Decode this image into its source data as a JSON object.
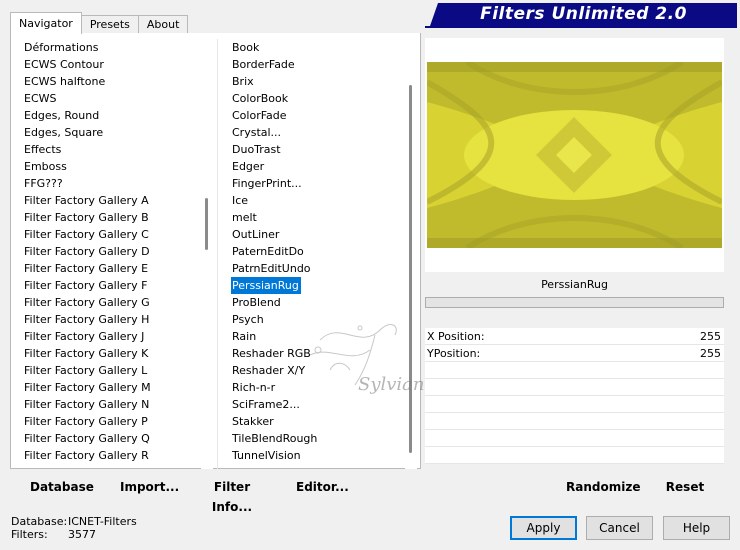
{
  "tabs": [
    {
      "label": "Navigator",
      "active": true
    },
    {
      "label": "Presets",
      "active": false
    },
    {
      "label": "About",
      "active": false
    }
  ],
  "banner": {
    "title": "Filters Unlimited 2.0",
    "color": "#0a0a84"
  },
  "categories": [
    "Déformations",
    "ECWS Contour",
    "ECWS halftone",
    "ECWS",
    "Edges, Round",
    "Edges, Square",
    "Effects",
    "Emboss",
    "FFG???",
    "Filter Factory Gallery A",
    "Filter Factory Gallery B",
    "Filter Factory Gallery C",
    "Filter Factory Gallery D",
    "Filter Factory Gallery E",
    "Filter Factory Gallery F",
    "Filter Factory Gallery G",
    "Filter Factory Gallery H",
    "Filter Factory Gallery J",
    "Filter Factory Gallery K",
    "Filter Factory Gallery L",
    "Filter Factory Gallery M",
    "Filter Factory Gallery N",
    "Filter Factory Gallery P",
    "Filter Factory Gallery Q",
    "Filter Factory Gallery R"
  ],
  "filters": [
    "Book",
    "BorderFade",
    "Brix",
    "ColorBook",
    "ColorFade",
    "Crystal...",
    "DuoTrast",
    "Edger",
    "FingerPrint...",
    "Ice",
    "melt",
    "OutLiner",
    "PaternEditDo",
    "PatrnEditUndo",
    "PerssianRug",
    "ProBlend",
    "Psych",
    "Rain",
    "Reshader RGB",
    "Reshader X/Y",
    "Rich-n-r",
    "SciFrame2...",
    "Stakker",
    "TileBlendRough",
    "TunnelVision"
  ],
  "selected_filter_index": 14,
  "preview": {
    "filter_name": "PerssianRug",
    "accent": "#d8d232"
  },
  "params": [
    {
      "label": "X Position:",
      "value": "255"
    },
    {
      "label": "YPosition:",
      "value": "255"
    }
  ],
  "buttons": {
    "database": "Database",
    "import": "Import...",
    "filter_info": "Filter Info...",
    "editor": "Editor...",
    "randomize": "Randomize",
    "reset": "Reset",
    "apply": "Apply",
    "cancel": "Cancel",
    "help": "Help"
  },
  "status": {
    "database_label": "Database:",
    "database_value": "ICNET-Filters",
    "filters_label": "Filters:",
    "filters_value": "3577"
  },
  "watermark": {
    "text": "Sylviane"
  }
}
